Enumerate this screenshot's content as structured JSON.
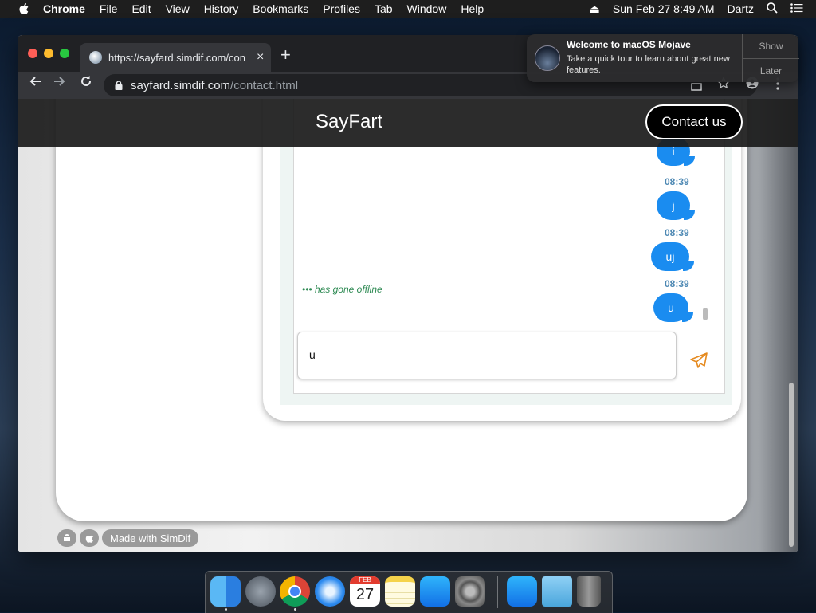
{
  "menubar": {
    "app": "Chrome",
    "items": [
      "File",
      "Edit",
      "View",
      "History",
      "Bookmarks",
      "Profiles",
      "Tab",
      "Window",
      "Help"
    ],
    "datetime": "Sun Feb 27  8:49 AM",
    "user": "Dartz"
  },
  "browser": {
    "tab_title": "https://sayfard.simdif.com/con",
    "new_tab": "+",
    "close": "×",
    "url_host": "sayfard.simdif.com",
    "url_path": "/contact.html"
  },
  "site": {
    "name": "SayFart",
    "contact_button": "Contact us"
  },
  "chat": {
    "messages": [
      {
        "text": "i",
        "time": "08:39"
      },
      {
        "text": "j",
        "time": "08:39"
      },
      {
        "text": "uj",
        "time": "08:39"
      },
      {
        "text": "u",
        "time": ""
      }
    ],
    "status": "••• has gone offline",
    "input_value": "u"
  },
  "footer": {
    "made_with": "Made with SimDif"
  },
  "notification": {
    "title": "Welcome to macOS Mojave",
    "body": "Take a quick tour to learn about great new features.",
    "show": "Show",
    "later": "Later"
  },
  "dock": {
    "calendar_month": "FEB",
    "calendar_day": "27",
    "apps": [
      "finder",
      "launchpad",
      "chrome",
      "safari",
      "calendar",
      "notes",
      "app-store",
      "system-preferences",
      "app-store-2",
      "downloads-folder",
      "trash"
    ]
  },
  "colors": {
    "bubble": "#1a8cf0",
    "timestamp": "#4d88b3",
    "offline": "#2e8a53",
    "send": "#e58a1f"
  }
}
